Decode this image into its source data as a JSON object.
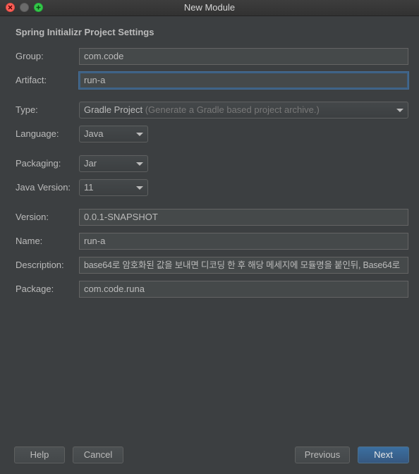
{
  "window": {
    "title": "New Module"
  },
  "section": {
    "title": "Spring Initializr Project Settings"
  },
  "form": {
    "group": {
      "label": "Group:",
      "value": "com.code"
    },
    "artifact": {
      "label": "Artifact:",
      "value": "run-a"
    },
    "type": {
      "label": "Type:",
      "value": "Gradle Project",
      "hint": "(Generate a Gradle based project archive.)"
    },
    "language": {
      "label": "Language:",
      "value": "Java"
    },
    "packaging": {
      "label": "Packaging:",
      "value": "Jar"
    },
    "java_version": {
      "label": "Java Version:",
      "value": "11"
    },
    "version": {
      "label": "Version:",
      "value": "0.0.1-SNAPSHOT"
    },
    "name": {
      "label": "Name:",
      "value": "run-a"
    },
    "description": {
      "label": "Description:",
      "value": "base64로 암호화된 값을 보내면 디코딩 한 후 해당 메세지에 모듈명을 붙인뒤, Base64로"
    },
    "package": {
      "label": "Package:",
      "value": "com.code.runa"
    }
  },
  "buttons": {
    "help": "Help",
    "cancel": "Cancel",
    "previous": "Previous",
    "next": "Next"
  },
  "colors": {
    "background": "#3c3f41",
    "field": "#45494a",
    "focus_border": "#3d6185",
    "primary_button": "#365880",
    "text": "#bbbbbb"
  }
}
